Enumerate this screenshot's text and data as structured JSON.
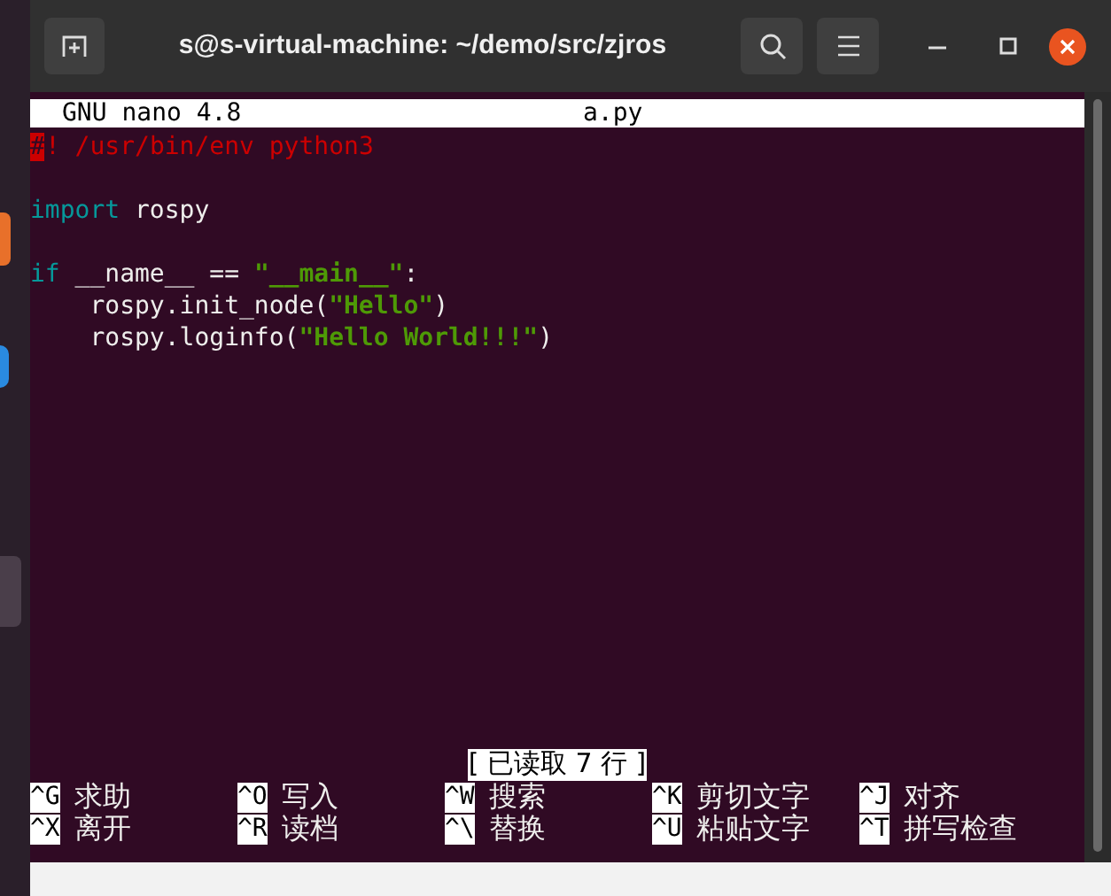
{
  "window": {
    "title": "s@s-virtual-machine: ~/demo/src/zjros"
  },
  "nano": {
    "version": "GNU nano 4.8",
    "filename": "a.py"
  },
  "code_blocks": [
    {
      "lines": [
        [
          {
            "text": "#",
            "kind": "cursor"
          },
          {
            "text": "! /usr/bin/env python3",
            "kind": "comment"
          }
        ]
      ]
    },
    {
      "lines": [
        [
          {
            "text": "import",
            "kind": "keyword"
          },
          {
            "text": " rospy",
            "kind": "plain"
          }
        ]
      ]
    },
    {
      "lines": [
        [
          {
            "text": "if",
            "kind": "keyword"
          },
          {
            "text": " __name__ == ",
            "kind": "plain"
          },
          {
            "text": "\"__main__\"",
            "kind": "string"
          },
          {
            "text": ":",
            "kind": "plain"
          }
        ],
        [
          {
            "text": "    rospy.init_node(",
            "kind": "plain"
          },
          {
            "text": "\"Hello\"",
            "kind": "string"
          },
          {
            "text": ")",
            "kind": "plain"
          }
        ],
        [
          {
            "text": "    rospy.loginfo(",
            "kind": "plain"
          },
          {
            "text": "\"Hello World!!!\"",
            "kind": "string"
          },
          {
            "text": ")",
            "kind": "plain"
          }
        ]
      ]
    }
  ],
  "status": "[ 已读取 7 行 ]",
  "shortcuts": [
    [
      {
        "key": "^G",
        "label": "求助"
      },
      {
        "key": "^O",
        "label": "写入"
      },
      {
        "key": "^W",
        "label": "搜索"
      },
      {
        "key": "^K",
        "label": "剪切文字"
      },
      {
        "key": "^J",
        "label": "对齐"
      }
    ],
    [
      {
        "key": "^X",
        "label": "离开"
      },
      {
        "key": "^R",
        "label": "读档"
      },
      {
        "key": "^\\",
        "label": "替换"
      },
      {
        "key": "^U",
        "label": "粘贴文字"
      },
      {
        "key": "^T",
        "label": "拼写检查"
      }
    ]
  ]
}
